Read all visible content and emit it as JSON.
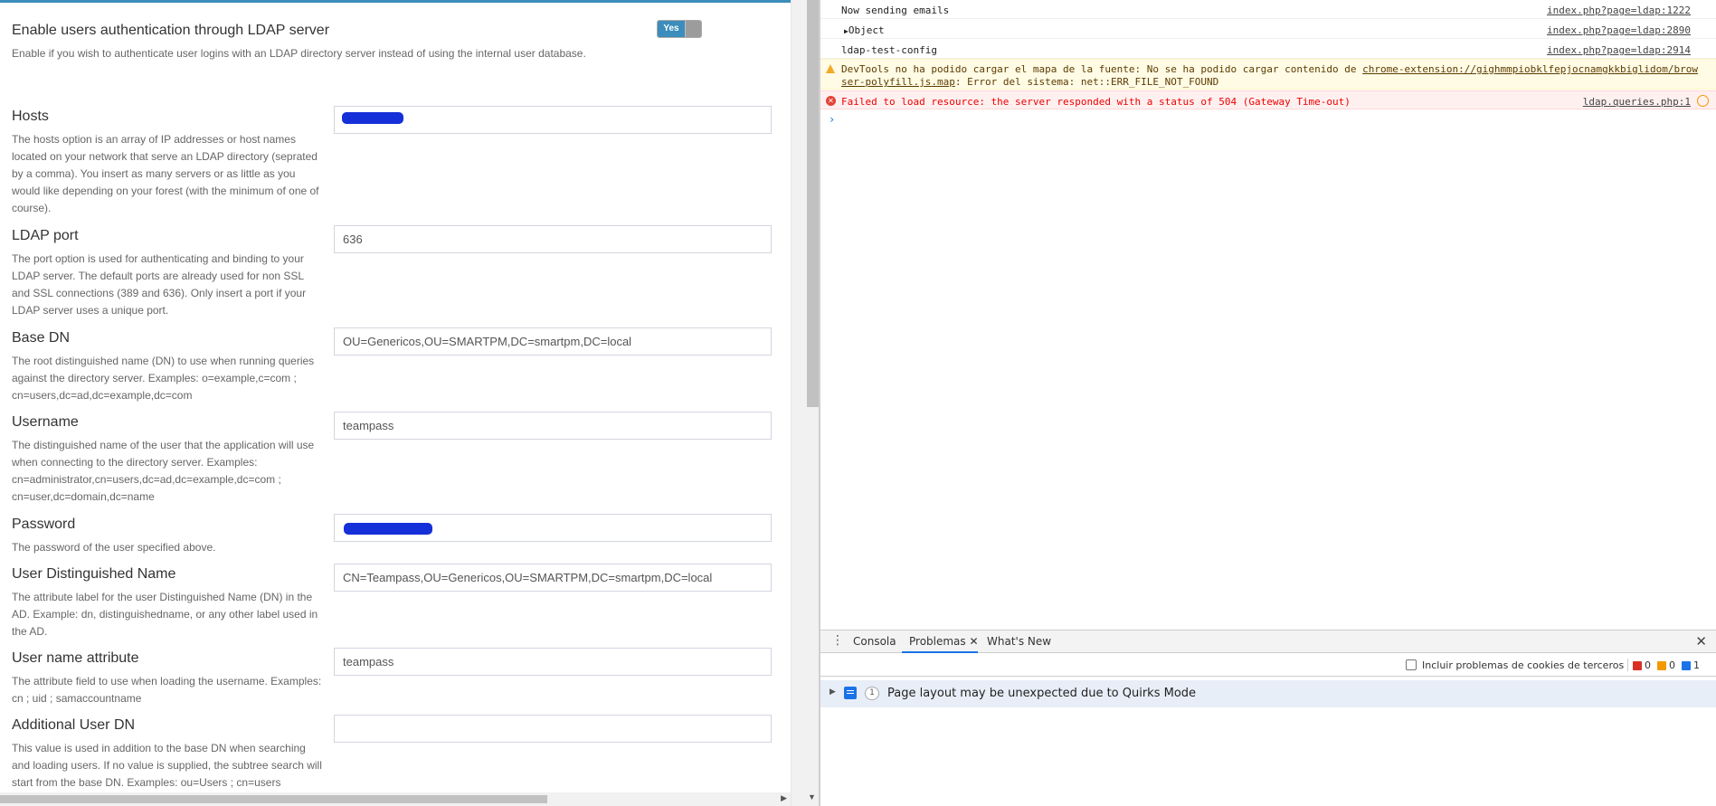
{
  "ldap_settings": {
    "enable": {
      "title": "Enable users authentication through LDAP server",
      "description": "Enable if you wish to authenticate user logins with an LDAP directory server instead of using the internal user database.",
      "toggle_label": "Yes",
      "enabled": true
    },
    "fields": [
      {
        "title": "Hosts",
        "description": "The hosts option is an array of IP addresses or host names located on your network that serve an LDAP directory (seprated by a comma). You insert as many servers or as little as you would like depending on your forest (with the minimum of one of course).",
        "value": ""
      },
      {
        "title": "LDAP port",
        "description": "The port option is used for authenticating and binding to your LDAP server. The default ports are already used for non SSL and SSL connections (389 and 636). Only insert a port if your LDAP server uses a unique port.",
        "value": "636"
      },
      {
        "title": "Base DN",
        "description": "The root distinguished name (DN) to use when running queries against the directory server. Examples: o=example,c=com ; cn=users,dc=ad,dc=example,dc=com",
        "value": "OU=Genericos,OU=SMARTPM,DC=smartpm,DC=local"
      },
      {
        "title": "Username",
        "description": "The distinguished name of the user that the application will use when connecting to the directory server. Examples: cn=administrator,cn=users,dc=ad,dc=example,dc=com ; cn=user,dc=domain,dc=name",
        "value": "teampass"
      },
      {
        "title": "Password",
        "description": "The password of the user specified above.",
        "value": ""
      },
      {
        "title": "User Distinguished Name",
        "description": "The attribute label for the user Distinguished Name (DN) in the AD. Example: dn, distinguishedname, or any other label used in the AD.",
        "value": "CN=Teampass,OU=Genericos,OU=SMARTPM,DC=smartpm,DC=local"
      },
      {
        "title": "User name attribute",
        "description": "The attribute field to use when loading the username. Examples: cn ; uid ; samaccountname",
        "value": "teampass"
      },
      {
        "title": "Additional User DN",
        "description": "This value is used in addition to the base DN when searching and loading users. If no value is supplied, the subtree search will start from the base DN. Examples: ou=Users ; cn=users",
        "value": ""
      }
    ]
  },
  "devtools": {
    "console": [
      {
        "type": "log",
        "text": "Now sending emails",
        "source": "index.php?page=ldap:1222"
      },
      {
        "type": "object",
        "text": "Object",
        "source": "index.php?page=ldap:2890"
      },
      {
        "type": "log",
        "text": "ldap-test-config",
        "source": "index.php?page=ldap:2914"
      },
      {
        "type": "warning",
        "text_before": "DevTools no ha podido cargar el mapa de la fuente: No se ha podido cargar contenido de ",
        "link": "chrome-extension://gighmmpiobklfepjocnamgkkbiglidom/brow",
        "link2": "ser-polyfill.js.map",
        "text_after": ": Error del sistema: net::ERR_FILE_NOT_FOUND"
      },
      {
        "type": "error",
        "text": "Failed to load resource: the server responded with a status of 504 (Gateway Time-out)",
        "source": "ldap.queries.php:1"
      }
    ],
    "prompt": "›",
    "drawer": {
      "tabs": [
        "Consola",
        "Problemas",
        "What's New"
      ],
      "active_tab": "Problemas",
      "third_party_cookies_label": "Incluir problemas de cookies de terceros",
      "counts": {
        "errors": "0",
        "warnings": "0",
        "info": "1"
      },
      "issue": {
        "count": "1",
        "text": "Page layout may be unexpected due to Quirks Mode"
      }
    }
  },
  "colors": {
    "accent": "#3c8dbc",
    "devtools_blue": "#1a73e8",
    "error_red": "#e00000",
    "warning_bg": "#fffbe5"
  }
}
